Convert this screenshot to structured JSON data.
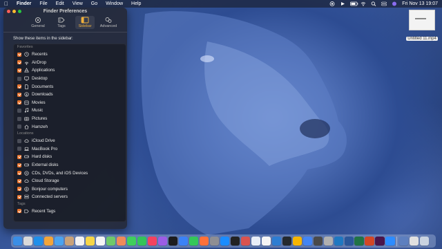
{
  "menubar": {
    "apple_icon": "apple-icon",
    "menus": [
      "Finder",
      "File",
      "Edit",
      "View",
      "Go",
      "Window",
      "Help"
    ],
    "clock": "Fri Nov 13  19:07"
  },
  "desktop": {
    "file_name": "Untitled 11.mp4"
  },
  "preferences": {
    "title": "Finder Preferences",
    "tabs": [
      {
        "label": "General",
        "icon": "gear-icon",
        "active": false
      },
      {
        "label": "Tags",
        "icon": "tag-icon",
        "active": false
      },
      {
        "label": "Sidebar",
        "icon": "sidebar-icon",
        "active": true
      },
      {
        "label": "Advanced",
        "icon": "gears-icon",
        "active": false
      }
    ],
    "prompt": "Show these items in the sidebar:",
    "groups": [
      {
        "header": "Favorites",
        "items": [
          {
            "label": "Recents",
            "checked": true,
            "icon": "clock-icon"
          },
          {
            "label": "AirDrop",
            "checked": true,
            "icon": "airdrop-icon"
          },
          {
            "label": "Applications",
            "checked": true,
            "icon": "applications-icon"
          },
          {
            "label": "Desktop",
            "checked": false,
            "icon": "desktop-icon"
          },
          {
            "label": "Documents",
            "checked": true,
            "icon": "document-icon"
          },
          {
            "label": "Downloads",
            "checked": true,
            "icon": "download-icon"
          },
          {
            "label": "Movies",
            "checked": true,
            "icon": "film-icon"
          },
          {
            "label": "Music",
            "checked": false,
            "icon": "music-icon"
          },
          {
            "label": "Pictures",
            "checked": false,
            "icon": "camera-icon"
          },
          {
            "label": "Hamzeh",
            "checked": false,
            "icon": "home-icon"
          }
        ]
      },
      {
        "header": "Locations",
        "items": [
          {
            "label": "iCloud Drive",
            "checked": false,
            "icon": "cloud-icon"
          },
          {
            "label": "MacBook Pro",
            "checked": false,
            "icon": "laptop-icon"
          },
          {
            "label": "Hard disks",
            "checked": true,
            "icon": "disk-icon"
          },
          {
            "label": "External disks",
            "checked": true,
            "icon": "disk-icon"
          },
          {
            "label": "CDs, DVDs, and iOS Devices",
            "checked": true,
            "icon": "disc-icon"
          },
          {
            "label": "Cloud Storage",
            "checked": true,
            "icon": "cloud-icon"
          },
          {
            "label": "Bonjour computers",
            "checked": true,
            "icon": "network-icon"
          },
          {
            "label": "Connected servers",
            "checked": true,
            "icon": "server-icon"
          }
        ]
      },
      {
        "header": "Tags",
        "items": [
          {
            "label": "Recent Tags",
            "checked": true,
            "icon": "tag-icon"
          }
        ]
      }
    ]
  },
  "dock": {
    "apps": [
      {
        "name": "finder-icon",
        "color": "#3a8ee6"
      },
      {
        "name": "launchpad-icon",
        "color": "#d9d9d9"
      },
      {
        "name": "safari-icon",
        "color": "#1f8fea"
      },
      {
        "name": "pages-icon",
        "color": "#f3a53a"
      },
      {
        "name": "mail-icon",
        "color": "#4aa3f0"
      },
      {
        "name": "contacts-icon",
        "color": "#c8a27a"
      },
      {
        "name": "calendar-icon",
        "color": "#f2f2f2"
      },
      {
        "name": "notes-icon",
        "color": "#f6d648"
      },
      {
        "name": "reminders-icon",
        "color": "#f5f5f5"
      },
      {
        "name": "maps-icon",
        "color": "#6fc96a"
      },
      {
        "name": "photos-icon",
        "color": "#f08a5a"
      },
      {
        "name": "messages-icon",
        "color": "#3fcf5c"
      },
      {
        "name": "facetime-icon",
        "color": "#33c459"
      },
      {
        "name": "music-app-icon",
        "color": "#f3425f"
      },
      {
        "name": "podcasts-icon",
        "color": "#9b5de5"
      },
      {
        "name": "tv-icon",
        "color": "#1c1c1e"
      },
      {
        "name": "keynote-icon",
        "color": "#3b82f6"
      },
      {
        "name": "numbers-icon",
        "color": "#34c759"
      },
      {
        "name": "firefox-icon",
        "color": "#ff7139"
      },
      {
        "name": "system-preferences-icon",
        "color": "#8e8e93"
      },
      {
        "name": "app-store-icon",
        "color": "#1a8cff"
      },
      {
        "name": "terminal-icon",
        "color": "#222222"
      },
      {
        "name": "screen-recorder-icon",
        "color": "#d9534f"
      },
      {
        "name": "preview-icon",
        "color": "#e8eef7"
      },
      {
        "name": "textedit-icon",
        "color": "#f5f5f5"
      },
      {
        "name": "xcode-icon",
        "color": "#2d7dd2"
      },
      {
        "name": "github-icon",
        "color": "#24292e"
      },
      {
        "name": "sketch-icon",
        "color": "#f7b500"
      },
      {
        "name": "chrome-icon",
        "color": "#4285f4"
      },
      {
        "name": "activity-monitor-icon",
        "color": "#4a4a4a"
      },
      {
        "name": "disk-utility-icon",
        "color": "#b0b0b0"
      },
      {
        "name": "vscode-icon",
        "color": "#1f78c1"
      },
      {
        "name": "word-icon",
        "color": "#2b579a"
      },
      {
        "name": "excel-icon",
        "color": "#217346"
      },
      {
        "name": "powerpoint-icon",
        "color": "#d24726"
      },
      {
        "name": "slack-icon",
        "color": "#4a154b"
      },
      {
        "name": "zoom-icon",
        "color": "#2d8cff"
      }
    ],
    "trailing": [
      {
        "name": "downloads-stack-icon",
        "color": "#5d7fbf"
      },
      {
        "name": "recent-video-icon",
        "color": "#e0e0e0"
      },
      {
        "name": "trash-icon",
        "color": "#c9d3e0"
      }
    ]
  }
}
